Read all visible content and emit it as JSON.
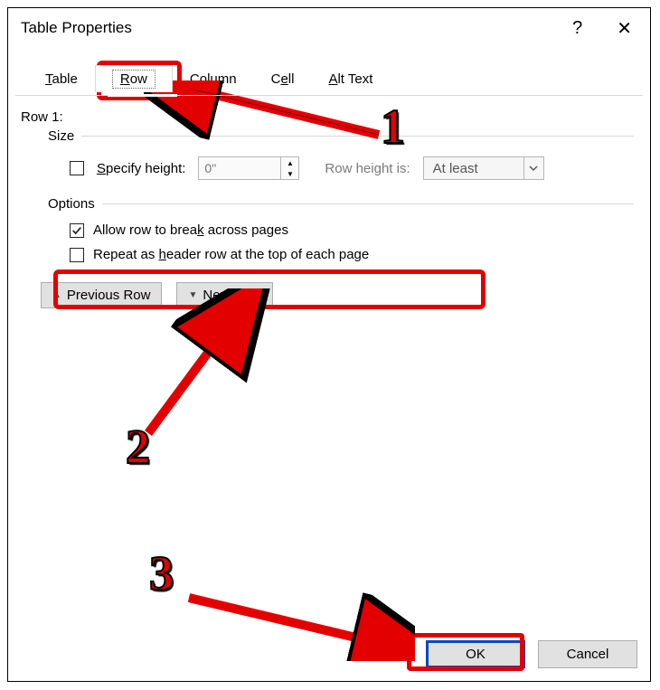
{
  "title": "Table Properties",
  "tabs": {
    "table": "Table",
    "row": "Row",
    "column": "Column",
    "cell": "Cell",
    "alt": "Alt Text"
  },
  "row": {
    "heading": "Row 1:",
    "size_label": "Size",
    "specify_height_label": "Specify height:",
    "height_value": "0\"",
    "row_height_is_label": "Row height is:",
    "row_height_mode": "At least",
    "options_label": "Options",
    "allow_break_label": "Allow row to break across pages",
    "repeat_header_label": "Repeat as header row at the top of each page",
    "prev_label": "Previous Row",
    "next_label": "Next Row"
  },
  "footer": {
    "ok": "OK",
    "cancel": "Cancel"
  },
  "annotations": {
    "n1": "1",
    "n2": "2",
    "n3": "3"
  }
}
